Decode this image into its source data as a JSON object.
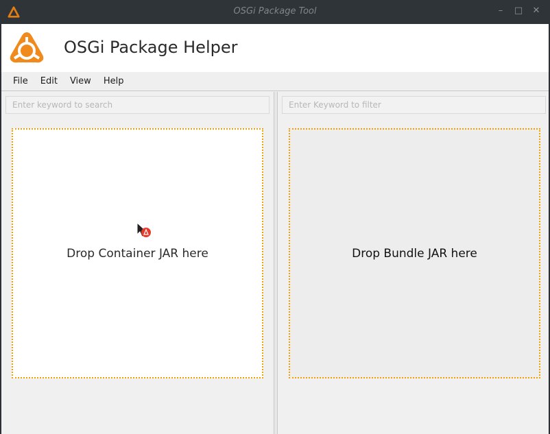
{
  "window": {
    "title": "OSGi Package Tool",
    "controls": {
      "minimize": "–",
      "maximize": "□",
      "close": "✕"
    }
  },
  "header": {
    "title": "OSGi Package Helper"
  },
  "menu": {
    "items": [
      "File",
      "Edit",
      "View",
      "Help"
    ]
  },
  "left_panel": {
    "search_placeholder": "Enter keyword to search",
    "drop_label": "Drop Container JAR here"
  },
  "right_panel": {
    "search_placeholder": "Enter Keyword to filter",
    "drop_label": "Drop Bundle JAR here"
  },
  "colors": {
    "accent": "#f0a300",
    "titlebar": "#2f3438",
    "logo": "#f08a1c"
  },
  "icons": [
    "osgi-logo-icon",
    "minimize-icon",
    "maximize-icon",
    "close-icon",
    "drag-cursor-icon"
  ]
}
